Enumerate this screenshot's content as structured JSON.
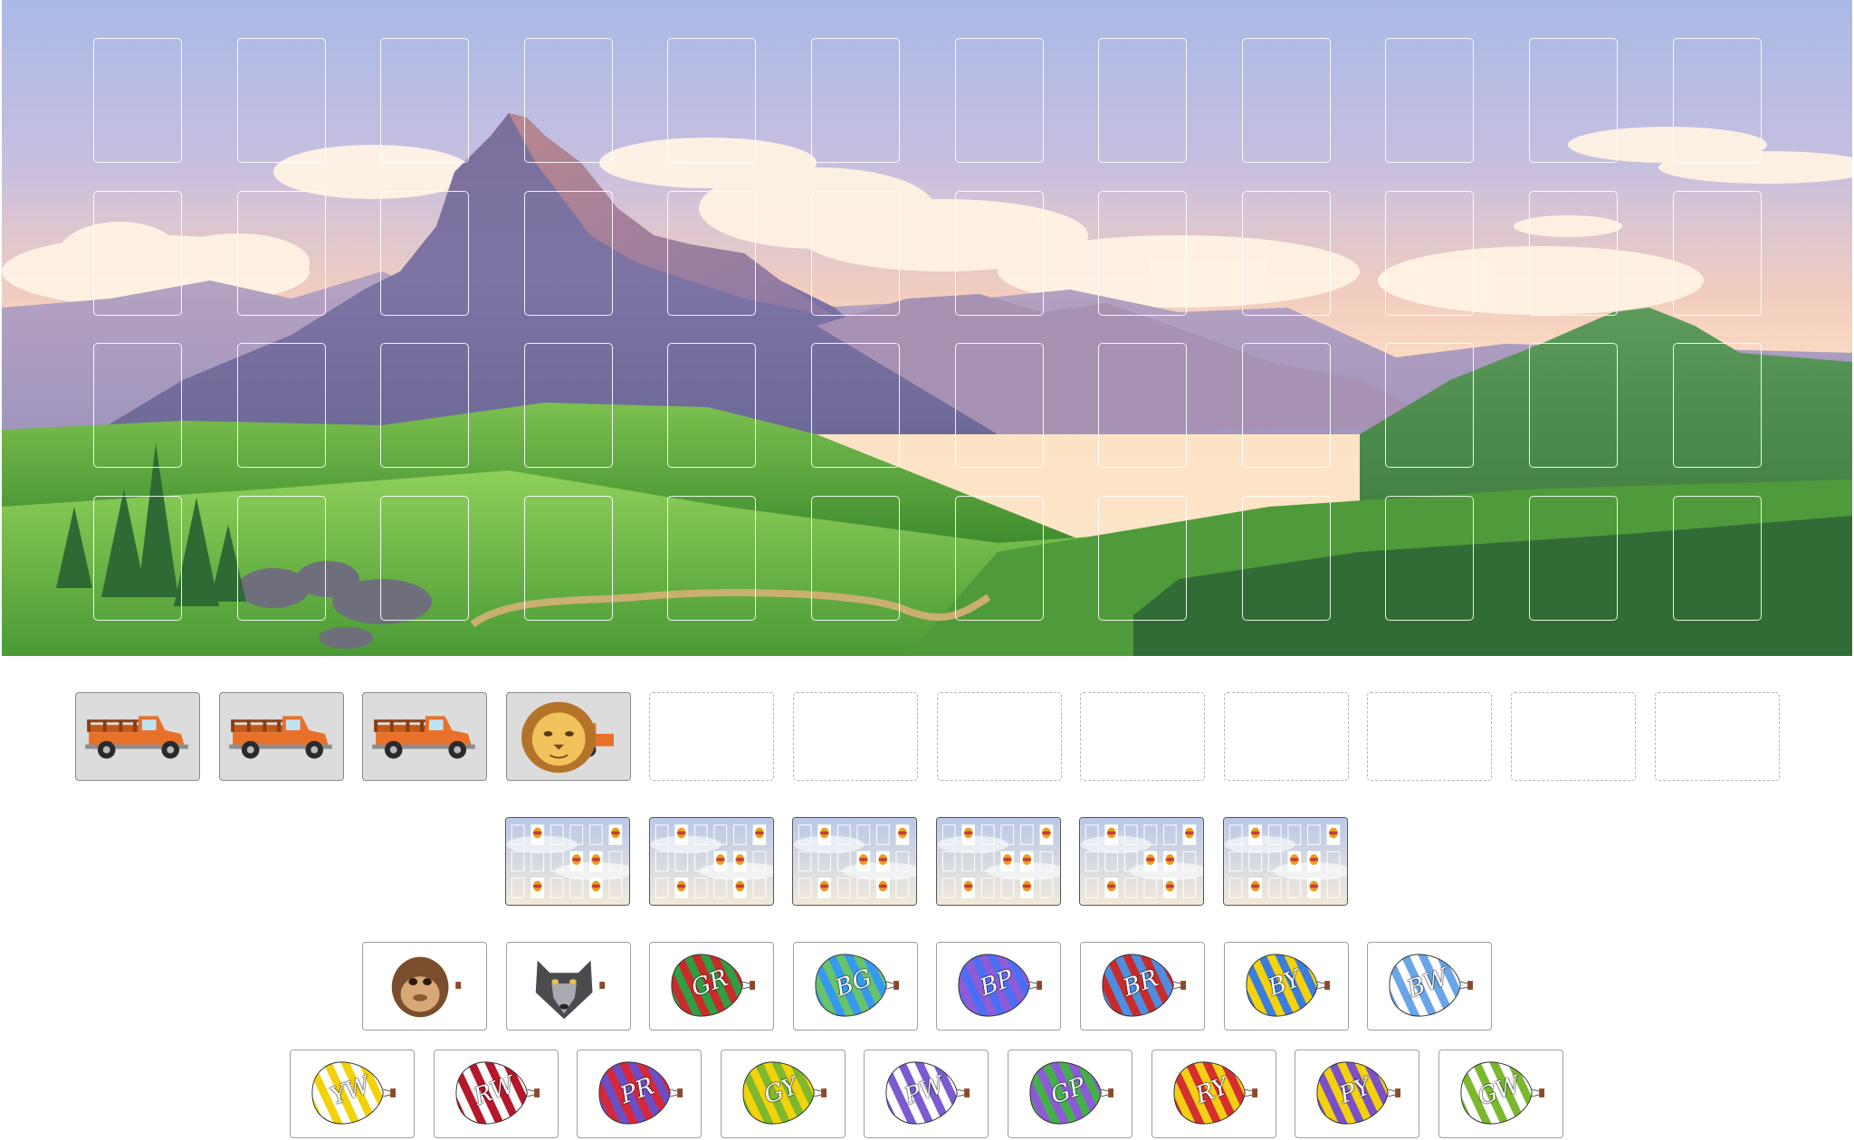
{
  "board": {
    "background": "mountain-valley-landscape",
    "grid": {
      "rows": 4,
      "cols": 12
    }
  },
  "hand": [
    {
      "kind": "truck",
      "icon": "truck-icon"
    },
    {
      "kind": "truck",
      "icon": "truck-icon"
    },
    {
      "kind": "truck",
      "icon": "truck-icon"
    },
    {
      "kind": "lion",
      "icon": "lion-icon"
    },
    {
      "kind": "empty"
    },
    {
      "kind": "empty"
    },
    {
      "kind": "empty"
    },
    {
      "kind": "empty"
    },
    {
      "kind": "empty"
    },
    {
      "kind": "empty"
    },
    {
      "kind": "empty"
    },
    {
      "kind": "empty"
    }
  ],
  "mini_boards": {
    "count": 6,
    "icon": "mini-board-icon"
  },
  "pieces_row1": [
    {
      "kind": "monkey",
      "icon": "monkey-icon"
    },
    {
      "kind": "wolf",
      "icon": "wolf-icon"
    },
    {
      "kind": "balloon",
      "label": "GR",
      "colors": [
        "#2f9e44",
        "#c92a2a"
      ]
    },
    {
      "kind": "balloon",
      "label": "BG",
      "colors": [
        "#339af0",
        "#69c36b"
      ]
    },
    {
      "kind": "balloon",
      "label": "BP",
      "colors": [
        "#4c6ef5",
        "#8e5cd6"
      ]
    },
    {
      "kind": "balloon",
      "label": "BR",
      "colors": [
        "#4c8fe0",
        "#c92a2a"
      ]
    },
    {
      "kind": "balloon",
      "label": "BY",
      "colors": [
        "#3b7ddd",
        "#f5d20a"
      ]
    },
    {
      "kind": "balloon",
      "label": "BW",
      "colors": [
        "#6aa5e8",
        "#ffffff"
      ]
    }
  ],
  "pieces_row2": [
    {
      "kind": "balloon",
      "label": "YW",
      "colors": [
        "#f2d20a",
        "#ffffff"
      ]
    },
    {
      "kind": "balloon",
      "label": "RW",
      "colors": [
        "#b5172b",
        "#ffffff"
      ]
    },
    {
      "kind": "balloon",
      "label": "PR",
      "colors": [
        "#6b4fc7",
        "#d6283b"
      ]
    },
    {
      "kind": "balloon",
      "label": "GY",
      "colors": [
        "#7db82e",
        "#f2d20a"
      ]
    },
    {
      "kind": "balloon",
      "label": "PW",
      "colors": [
        "#7a5cd0",
        "#ffffff"
      ]
    },
    {
      "kind": "balloon",
      "label": "GP",
      "colors": [
        "#45b04a",
        "#8c5ad6"
      ]
    },
    {
      "kind": "balloon",
      "label": "RY",
      "colors": [
        "#d32f2f",
        "#f5cf14"
      ]
    },
    {
      "kind": "balloon",
      "label": "PY",
      "colors": [
        "#7b4fc9",
        "#f2d20a"
      ]
    },
    {
      "kind": "balloon",
      "label": "GW",
      "colors": [
        "#7bb82e",
        "#ffffff"
      ]
    }
  ]
}
